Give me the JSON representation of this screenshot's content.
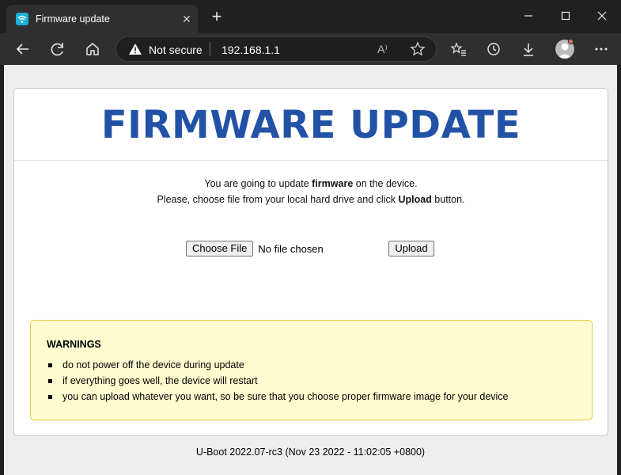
{
  "browser": {
    "tab": {
      "title": "Firmware update",
      "close_glyph": "✕"
    },
    "new_tab_glyph": "+",
    "address": {
      "security_label": "Not secure",
      "url": "192.168.1.1",
      "read_aloud_glyph": "A⁾"
    }
  },
  "page": {
    "headline": "FIRMWARE UPDATE",
    "instructions": {
      "line1_pre": "You are going to update ",
      "line1_bold": "firmware",
      "line1_post": " on the device.",
      "line2_pre": "Please, choose file from your local hard drive and click ",
      "line2_bold": "Upload",
      "line2_post": " button."
    },
    "file_input": {
      "choose_label": "Choose File",
      "status": "No file chosen"
    },
    "upload_label": "Upload",
    "warnings": {
      "title": "WARNINGS",
      "items": [
        "do not power off the device during update",
        "if everything goes well, the device will restart",
        "you can upload whatever you want, so be sure that you choose proper firmware image for your device"
      ]
    },
    "footer": "U-Boot 2022.07-rc3 (Nov 23 2022 - 11:02:05 +0800)"
  },
  "colors": {
    "headline": "#2152a6",
    "warning_bg": "#fffdd0",
    "warning_border": "#e3c93e",
    "chrome_dark": "#202020"
  }
}
